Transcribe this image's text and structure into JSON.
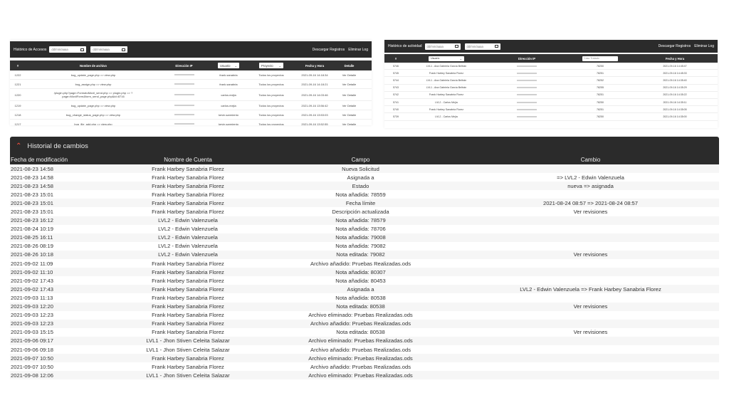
{
  "access": {
    "title": "Histórico de Accesos",
    "date_placeholder": "dd/mm/aaaa",
    "download": "Descargar Registros",
    "delete": "Eliminar Log",
    "columns": [
      "#",
      "Nombre de archivo",
      "Dirección IP",
      "Usuario",
      "Proyecto",
      "Fecha y Hora",
      "Detalle"
    ],
    "rows": [
      {
        "id": "1222",
        "file": "bug_update_page.php => view.php",
        "user": "frank.sanabria",
        "project": "Todos los proyectos",
        "datetime": "2021-09-16 14:18:34",
        "detail": "Ver Detalle"
      },
      {
        "id": "1221",
        "file": "bug_assign.php => view.php",
        "user": "frank.sanabria",
        "project": "Todos los proyectos",
        "datetime": "2021-09-16 14:18:21",
        "detail": "Ver Detalle"
      },
      {
        "id": "1220",
        "file": "/plugin.php?page=FormatoMovil_send.php => plugin.php => ?page=MovilForm&form_send_page.php&id=8716",
        "user": "carlos.mejia",
        "project": "Todos los proyectos",
        "datetime": "2021-09-16 14:03:46",
        "detail": "Ver Detalle"
      },
      {
        "id": "1219",
        "file": "bug_update_page.php => view.php",
        "user": "carlos.mejia",
        "project": "Todos los proyectos",
        "datetime": "2021-09-16 13:56:42",
        "detail": "Ver Detalle"
      },
      {
        "id": "1218",
        "file": "bug_change_status_page.php => view.php",
        "user": "kevin.sarmiento",
        "project": "Todos los proyectos",
        "datetime": "2021-09-16 13:53:03",
        "detail": "Ver Detalle"
      },
      {
        "id": "1217",
        "file": "bug_file_add.php => view.php",
        "user": "kevin.sarmiento",
        "project": "Todos los proyectos",
        "datetime": "2021-09-16 13:52:55",
        "detail": "Ver Detalle"
      }
    ]
  },
  "activity": {
    "title": "Histórico de actividad",
    "date_placeholder": "dd/mm/aaaa",
    "download": "Descargar Registros",
    "delete": "Eliminar Log",
    "columns": [
      "#",
      "Usuario",
      "Dirección IP",
      "Caso Tratado",
      "Fecha y Hora"
    ],
    "filter_placeholder": "Caso Tratado",
    "rows": [
      {
        "id": "5746",
        "user": "LVL1 - Ana Gabriela García Beltrán",
        "case": "78250",
        "datetime": "2021-09-16 14:45:47"
      },
      {
        "id": "5745",
        "user": "Frank Harbey Sanabria Florez",
        "case": "78251",
        "datetime": "2021-09-16 14:45:33"
      },
      {
        "id": "5744",
        "user": "LVL1 - Ana Gabriela García Beltrán",
        "case": "78252",
        "datetime": "2021-09-16 14:35:40"
      },
      {
        "id": "5743",
        "user": "LVL1 - Ana Gabriela García Beltrán",
        "case": "78255",
        "datetime": "2021-09-16 14:35:29"
      },
      {
        "id": "5742",
        "user": "Frank Harbey Sanabria Florez",
        "case": "78251",
        "datetime": "2021-09-16 14:35:22"
      },
      {
        "id": "5741",
        "user": "LVL2 - Carlos Mejía",
        "case": "78250",
        "datetime": "2021-09-16 14:35:11"
      },
      {
        "id": "5740",
        "user": "Frank Harbey Sanabria Florez",
        "case": "78251",
        "datetime": "2021-09-16 14:35:05"
      },
      {
        "id": "5739",
        "user": "LVL2 - Carlos Mejía",
        "case": "78250",
        "datetime": "2021-09-16 14:35:00"
      }
    ]
  },
  "history": {
    "title": "Historial de cambios",
    "columns": [
      "Fecha de modificación",
      "Nombre de Cuenta",
      "Campo",
      "Cambio"
    ],
    "rows": [
      [
        "2021-08-23 14:58",
        "Frank Harbey Sanabria Florez",
        "Nueva Solicitud",
        ""
      ],
      [
        "2021-08-23 14:58",
        "Frank Harbey Sanabria Florez",
        "Asignada a",
        "=> LVL2 - Edwin Valenzuela"
      ],
      [
        "2021-08-23 14:58",
        "Frank Harbey Sanabria Florez",
        "Estado",
        "nueva => asignada"
      ],
      [
        "2021-08-23 15:01",
        "Frank Harbey Sanabria Florez",
        "Nota añadida: 78559",
        ""
      ],
      [
        "2021-08-23 15:01",
        "Frank Harbey Sanabria Florez",
        "Fecha límite",
        "2021-08-24 08:57 => 2021-08-24 08:57"
      ],
      [
        "2021-08-23 15:01",
        "Frank Harbey Sanabria Florez",
        "Descripción actualizada",
        "Ver revisiones"
      ],
      [
        "2021-08-23 16:12",
        "LVL2 - Edwin Valenzuela",
        "Nota añadida: 78579",
        ""
      ],
      [
        "2021-08-24 10:19",
        "LVL2 - Edwin Valenzuela",
        "Nota añadida: 78706",
        ""
      ],
      [
        "2021-08-25 16:11",
        "LVL2 - Edwin Valenzuela",
        "Nota añadida: 79008",
        ""
      ],
      [
        "2021-08-26 08:19",
        "LVL2 - Edwin Valenzuela",
        "Nota añadida: 79082",
        ""
      ],
      [
        "2021-08-26 10:18",
        "LVL2 - Edwin Valenzuela",
        "Nota editada: 79082",
        "Ver revisiones"
      ],
      [
        "2021-09-02 11:09",
        "Frank Harbey Sanabria Florez",
        "Archivo añadido: Pruebas Realizadas.ods",
        ""
      ],
      [
        "2021-09-02 11:10",
        "Frank Harbey Sanabria Florez",
        "Nota añadida: 80307",
        ""
      ],
      [
        "2021-09-02 17:43",
        "Frank Harbey Sanabria Florez",
        "Nota añadida: 80453",
        ""
      ],
      [
        "2021-09-02 17:43",
        "Frank Harbey Sanabria Florez",
        "Asignada a",
        "LVL2 - Edwin Valenzuela => Frank Harbey Sanabria Florez"
      ],
      [
        "2021-09-03 11:13",
        "Frank Harbey Sanabria Florez",
        "Nota añadida: 80538",
        ""
      ],
      [
        "2021-09-03 12:20",
        "Frank Harbey Sanabria Florez",
        "Nota editada: 80538",
        "Ver revisiones"
      ],
      [
        "2021-09-03 12:23",
        "Frank Harbey Sanabria Florez",
        "Archivo eliminado: Pruebas Realizadas.ods",
        ""
      ],
      [
        "2021-09-03 12:23",
        "Frank Harbey Sanabria Florez",
        "Archivo añadido: Pruebas Realizadas.ods",
        ""
      ],
      [
        "2021-09-03 15:15",
        "Frank Harbey Sanabria Florez",
        "Nota editada: 80538",
        "Ver revisiones"
      ],
      [
        "2021-09-06 09:17",
        "LVL1 - Jhon Stiven Celeita Salazar",
        "Archivo eliminado: Pruebas Realizadas.ods",
        ""
      ],
      [
        "2021-09-06 09:18",
        "LVL1 - Jhon Stiven Celeita Salazar",
        "Archivo añadido: Pruebas Realizadas.ods",
        ""
      ],
      [
        "2021-09-07 10:50",
        "Frank Harbey Sanabria Florez",
        "Archivo eliminado: Pruebas Realizadas.ods",
        ""
      ],
      [
        "2021-09-07 10:50",
        "Frank Harbey Sanabria Florez",
        "Archivo añadido: Pruebas Realizadas.ods",
        ""
      ],
      [
        "2021-09-08 12:06",
        "LVL1 - Jhon Stiven Celeita Salazar",
        "Archivo eliminado: Pruebas Realizadas.ods",
        ""
      ]
    ]
  },
  "icons": {
    "calendar": "calendar-icon",
    "collapse": "chevron-up-icon",
    "dropdown": "chevron-down-icon"
  },
  "colors": {
    "header_bg": "#2b2b2b",
    "accent": "#e74c3c"
  }
}
